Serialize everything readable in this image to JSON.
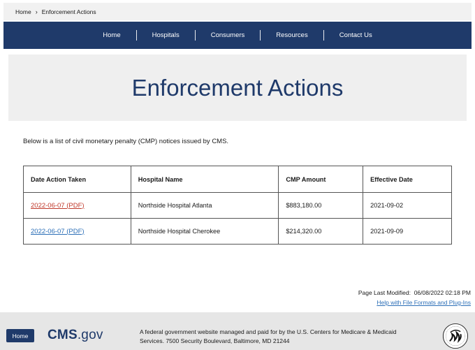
{
  "breadcrumb": {
    "home": "Home",
    "separator": "›",
    "current": "Enforcement Actions"
  },
  "nav": {
    "items": [
      "Home",
      "Hospitals",
      "Consumers",
      "Resources",
      "Contact Us"
    ]
  },
  "page": {
    "title": "Enforcement Actions",
    "intro": "Below is a list of civil monetary penalty (CMP) notices issued by CMS."
  },
  "table": {
    "headers": [
      "Date Action Taken",
      "Hospital Name",
      "CMP Amount",
      "Effective Date"
    ],
    "rows": [
      {
        "date": "2022-06-07 (PDF)",
        "hospital": "Northside Hospital Atlanta",
        "amount": "$883,180.00",
        "effective": "2021-09-02"
      },
      {
        "date": "2022-06-07 (PDF)",
        "hospital": "Northside Hospital Cherokee",
        "amount": "$214,320.00",
        "effective": "2021-09-09"
      }
    ]
  },
  "modified": {
    "label": "Page Last Modified:",
    "value": "06/08/2022 02:18 PM",
    "help_link": "Help with File Formats and Plug-Ins"
  },
  "footer": {
    "home_button": "Home",
    "logo_bold": "CMS",
    "logo_rest": ".gov",
    "gov_text": "A federal government website managed and paid for by the U.S. Centers for Medicare & Medicaid Services. 7500 Security Boulevard, Baltimore, MD 21244"
  },
  "colors": {
    "navy": "#1f3a6a",
    "link_visited": "#c0392b",
    "link": "#2c6fb7"
  }
}
